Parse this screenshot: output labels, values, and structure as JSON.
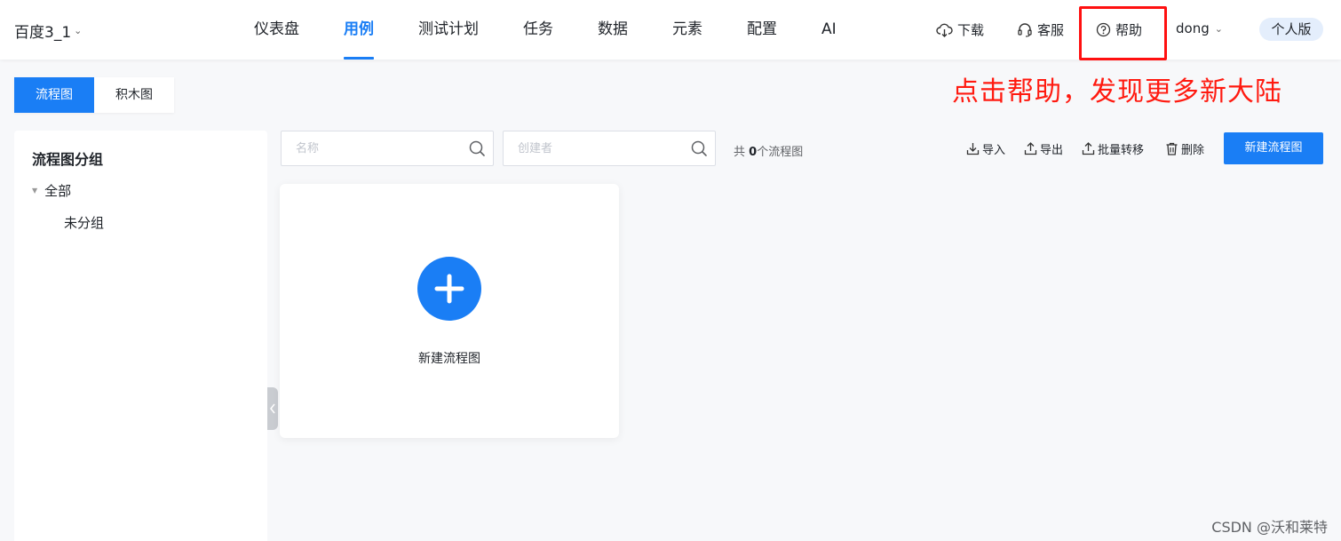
{
  "header": {
    "project_name": "百度3_1",
    "nav": [
      {
        "label": "仪表盘",
        "active": false
      },
      {
        "label": "用例",
        "active": true
      },
      {
        "label": "测试计划",
        "active": false
      },
      {
        "label": "任务",
        "active": false
      },
      {
        "label": "数据",
        "active": false
      },
      {
        "label": "元素",
        "active": false
      },
      {
        "label": "配置",
        "active": false
      },
      {
        "label": "AI",
        "active": false
      }
    ],
    "download": "下载",
    "service": "客服",
    "help": "帮助",
    "user": "dong",
    "edition": "个人版"
  },
  "annotation": "点击帮助，发现更多新大陆",
  "mode_tabs": {
    "flow": "流程图",
    "block": "积木图"
  },
  "sidebar": {
    "title": "流程图分组",
    "root": "全部",
    "children": [
      "未分组"
    ]
  },
  "toolbar": {
    "name_placeholder": "名称",
    "creator_placeholder": "创建者",
    "count_prefix": "共 ",
    "count": "0",
    "count_suffix": "个流程图",
    "import": "导入",
    "export": "导出",
    "batch_move": "批量转移",
    "delete": "删除",
    "new_flow": "新建流程图"
  },
  "card": {
    "label": "新建流程图"
  },
  "watermark": "CSDN @沃和莱特",
  "colors": {
    "primary": "#1a7ef5",
    "annotation": "#ff1a10"
  }
}
